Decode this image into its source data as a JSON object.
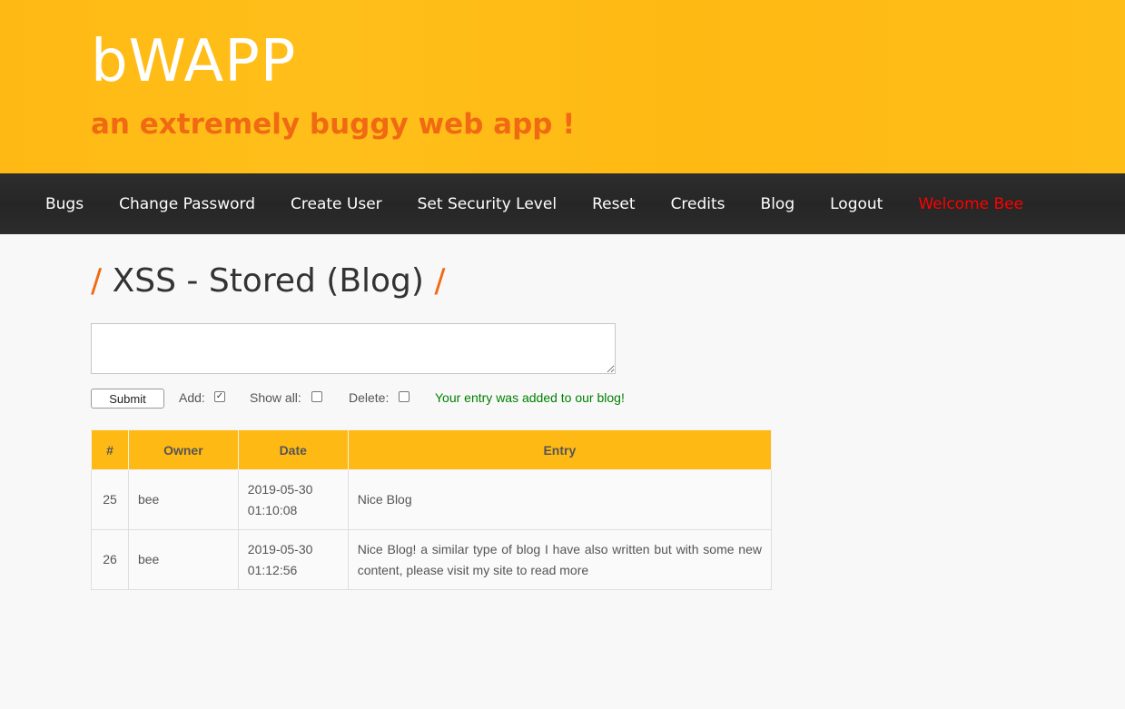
{
  "header": {
    "title": "bWAPP",
    "subtitle": "an extremely buggy web app !"
  },
  "menu": {
    "items": [
      "Bugs",
      "Change Password",
      "Create User",
      "Set Security Level",
      "Reset",
      "Credits",
      "Blog",
      "Logout"
    ],
    "welcome": "Welcome Bee"
  },
  "page": {
    "slash": "/",
    "title": "XSS - Stored (Blog)"
  },
  "form": {
    "entry_value": "",
    "submit_label": "Submit",
    "add_label": "Add:",
    "add_checked": true,
    "show_all_label": "Show all:",
    "show_all_checked": false,
    "delete_label": "Delete:",
    "delete_checked": false,
    "status": "Your entry was added to our blog!"
  },
  "table": {
    "headers": [
      "#",
      "Owner",
      "Date",
      "Entry"
    ],
    "rows": [
      {
        "id": "25",
        "owner": "bee",
        "date": "2019-05-30",
        "time": "01:10:08",
        "entry": "Nice Blog"
      },
      {
        "id": "26",
        "owner": "bee",
        "date": "2019-05-30",
        "time": "01:12:56",
        "entry": "Nice Blog! a similar type of blog I have also written but with some new content, please visit my site to read more"
      }
    ]
  },
  "colors": {
    "header_bg": "#ffb914",
    "menu_bg": "#2a2a2a",
    "accent": "#f06a13",
    "welcome": "#ff0000",
    "status": "#008000"
  }
}
